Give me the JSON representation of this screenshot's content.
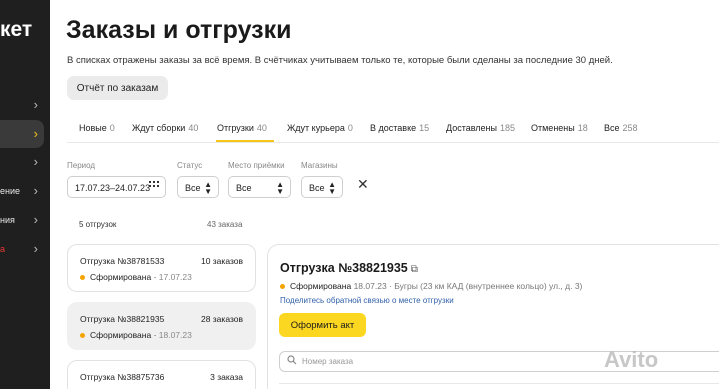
{
  "sidebar": {
    "logo": "кет",
    "items": [
      {
        "label": ""
      },
      {
        "label": ""
      },
      {
        "label": ""
      },
      {
        "label": "ение"
      },
      {
        "label": "ния"
      },
      {
        "label": "а"
      }
    ]
  },
  "header": {
    "title": "Заказы и отгрузки",
    "subtitle": "В списках отражены заказы за всё время. В счётчиках учитываем только те, которые были сделаны за последние 30 дней.",
    "report_button": "Отчёт по заказам"
  },
  "tabs": [
    {
      "label": "Новые",
      "count": "0"
    },
    {
      "label": "Ждут сборки",
      "count": "40"
    },
    {
      "label": "Отгрузки",
      "count": "40"
    },
    {
      "label": "Ждут курьера",
      "count": "0"
    },
    {
      "label": "В доставке",
      "count": "15"
    },
    {
      "label": "Доставлены",
      "count": "185"
    },
    {
      "label": "Отменены",
      "count": "18"
    },
    {
      "label": "Все",
      "count": "258"
    }
  ],
  "filters": {
    "period": {
      "label": "Период",
      "value": "17.07.23–24.07.23"
    },
    "status": {
      "label": "Статус",
      "value": "Все"
    },
    "place": {
      "label": "Место приёмки",
      "value": "Все"
    },
    "shops": {
      "label": "Магазины",
      "value": "Все"
    }
  },
  "list": {
    "shipments_count": "5 отгрузок",
    "orders_count": "43 заказа",
    "cards": [
      {
        "title": "Отгрузка №38781533",
        "count": "10 заказов",
        "status": "Сформирована",
        "date": "17.07.23"
      },
      {
        "title": "Отгрузка №38821935",
        "count": "28 заказов",
        "status": "Сформирована",
        "date": "18.07.23"
      },
      {
        "title": "Отгрузка №38875736",
        "count": "3 заказа",
        "status": "",
        "date": ""
      }
    ]
  },
  "detail": {
    "title": "Отгрузка №38821935",
    "status": "Сформирована",
    "meta": "18.07.23 · Бугры (23 км КАД (внутреннее кольцо) ул., д. 3)",
    "feedback_link": "Поделитесь обратной связью о месте отгрузки",
    "action_button": "Оформить акт",
    "search_placeholder": "Номер заказа"
  },
  "watermark": "Avito",
  "colors": {
    "accent": "#fcd722",
    "sidebar": "#1f1f1f",
    "status_dot": "#f5a300",
    "link": "#2f5fa8"
  }
}
